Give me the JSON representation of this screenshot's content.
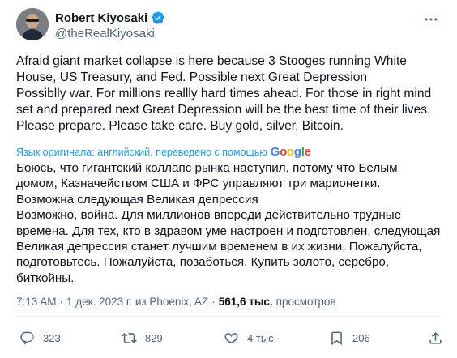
{
  "author": {
    "name": "Robert Kiyosaki",
    "handle": "@theRealKiyosaki"
  },
  "tweet": {
    "text": "Afraid giant market collapse is here because 3 Stooges running White House, US Treasury, and Fed. Possible next Great Depression\nPossiblly war. For millions reallly hard times ahead. For those in right mind set and prepared next Great Depression will be the best time of their lives. Please prepare. Please take care. Buy gold, silver, Bitcoin.",
    "translation_note": "Язык оригинала: английский, переведено с помощью",
    "translation_provider": "Google",
    "translated_text": "Боюсь, что гигантский коллапс рынка наступил, потому что Белым домом, Казначейством США и ФРС управляют три марионетки. Возможна следующая Великая депрессия\nВозможно, война. Для миллионов впереди действительно трудные времена. Для тех, кто в здравом уме настроен и подготовлен, следующая Великая депрессия станет лучшим временем в их жизни. Пожалуйста, подготовьтесь. Пожалуйста, позаботься. Купить золото, серебро, биткойны."
  },
  "meta": {
    "time": "7:13 AM",
    "date": "1 дек. 2023 г.",
    "location": "из Phoenix, AZ",
    "views_count": "561,6 тыс.",
    "views_label": "просмотров"
  },
  "actions": {
    "replies": "323",
    "retweets": "829",
    "likes": "4 тыс.",
    "bookmarks": "206"
  },
  "colors": {
    "accent": "#1d9bf0",
    "text": "#0f1419",
    "muted": "#536471"
  }
}
